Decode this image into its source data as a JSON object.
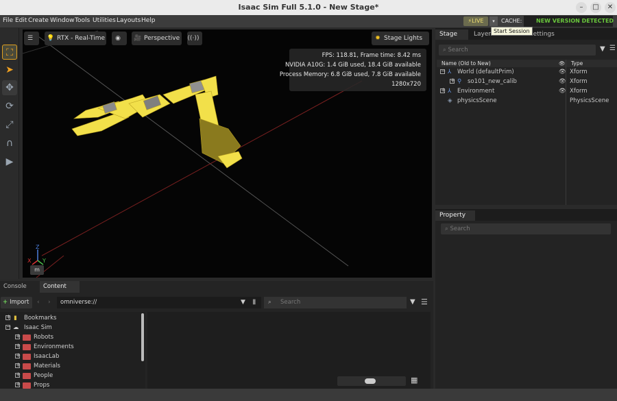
{
  "window": {
    "title": "Isaac Sim Full 5.1.0 - New Stage*",
    "minimize": "–",
    "maximize": "□",
    "close": "✕"
  },
  "menu": [
    "File",
    "Edit",
    "Create",
    "Window",
    "Tools",
    "Utilities",
    "Layouts",
    "Help"
  ],
  "live": {
    "label": "LIVE",
    "tooltip": "Start Session",
    "cache_label": "CACHE:",
    "new_version": "NEW VERSION DETECTED"
  },
  "viewport": {
    "renderer": "RTX - Real-Time",
    "camera": "Perspective",
    "lights": "Stage Lights",
    "stats": {
      "fps": "FPS: 118.81, Frame time: 8.42 ms",
      "gpu": "NVIDIA A10G: 1.4 GiB used, 18.4 GiB available",
      "memory": "Process Memory: 6.8 GiB used, 7.8 GiB available",
      "resolution": "1280x720"
    },
    "axes": {
      "x": "X",
      "y": "Y",
      "z": "Z"
    },
    "unit": "m"
  },
  "stage": {
    "tabs": [
      "Stage",
      "Layer",
      "Render Settings"
    ],
    "search_placeholder": "Search",
    "col_name": "Name (Old to New)",
    "col_type": "Type",
    "rows": [
      {
        "name": "World (defaultPrim)",
        "type": "Xform"
      },
      {
        "name": "so101_new_calib",
        "type": "Xform"
      },
      {
        "name": "Environment",
        "type": "Xform"
      },
      {
        "name": "physicsScene",
        "type": "PhysicsScene"
      }
    ]
  },
  "property": {
    "tab": "Property",
    "search_placeholder": "Search"
  },
  "content": {
    "tabs": [
      "Console",
      "Content"
    ],
    "import_label": "Import",
    "path": "omniverse://",
    "search_placeholder": "Search",
    "tree": [
      {
        "label": "Bookmarks"
      },
      {
        "label": "Isaac Sim"
      },
      {
        "label": "Robots"
      },
      {
        "label": "Environments"
      },
      {
        "label": "IsaacLab"
      },
      {
        "label": "Materials"
      },
      {
        "label": "People"
      },
      {
        "label": "Props"
      }
    ]
  },
  "colors": {
    "accent": "#f0a020",
    "robot": "#f2e04a",
    "new_version": "#69c63c",
    "folder": "#c84a4a"
  }
}
